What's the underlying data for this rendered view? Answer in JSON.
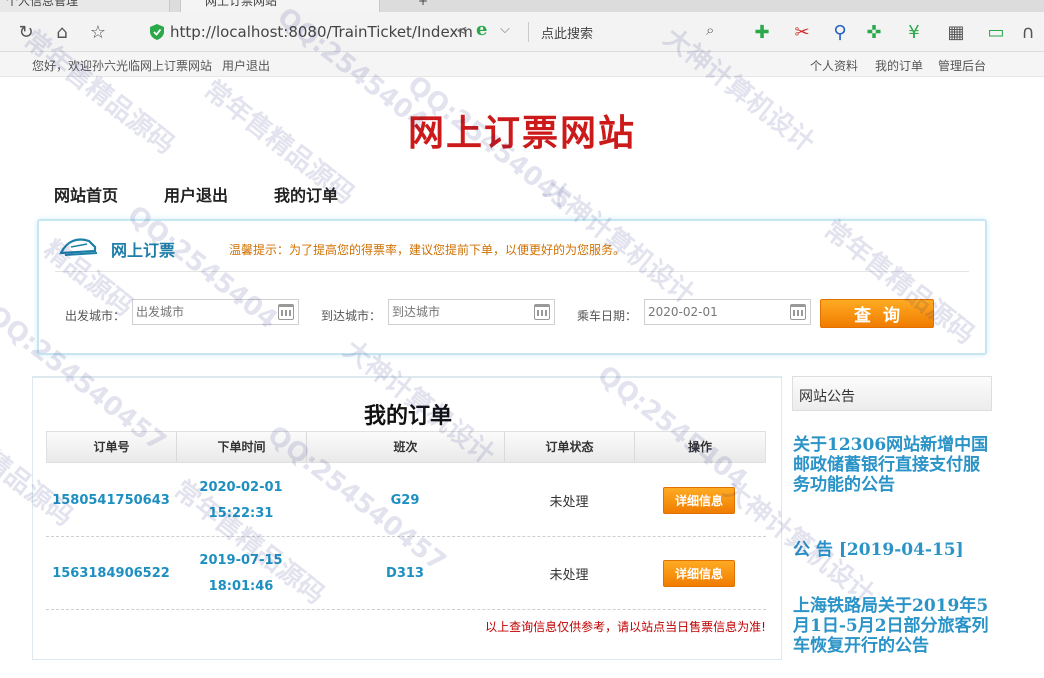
{
  "browser": {
    "tab_1_title": "个人信息管理",
    "tab_2_title": "网上订票网站",
    "url": "http://localhost:8080/TrainTicket/Indexm",
    "search_placeholder": "点此搜索"
  },
  "topbar": {
    "greeting": "您好，欢迎孙六光临网上订票网站",
    "logout": "用户退出",
    "links": [
      "个人资料",
      "我的订单",
      "管理后台"
    ]
  },
  "site_title": "网上订票网站",
  "nav": [
    "网站首页",
    "用户退出",
    "我的订单"
  ],
  "booking": {
    "title": "网上订票",
    "tip": "温馨提示：为了提高您的得票率，建议您提前下单，以便更好的为您服务。",
    "from_label": "出发城市：",
    "from_placeholder": "出发城市",
    "to_label": "到达城市：",
    "to_placeholder": "到达城市",
    "date_label": "乘车日期：",
    "date_value": "2020-02-01",
    "query_button": "查询"
  },
  "orders": {
    "title": "我的订单",
    "columns": [
      "订单号",
      "下单时间",
      "班次",
      "订单状态",
      "操作"
    ],
    "rows": [
      {
        "order_no": "1580541750643",
        "date": "2020-02-01",
        "time": "15:22:31",
        "train": "G29",
        "status": "未处理",
        "action": "详细信息"
      },
      {
        "order_no": "1563184906522",
        "date": "2019-07-15",
        "time": "18:01:46",
        "train": "D313",
        "status": "未处理",
        "action": "详细信息"
      }
    ],
    "disclaimer": "以上查询信息仅供参考，请以站点当日售票信息为准!"
  },
  "notice": {
    "title": "网站公告",
    "items": [
      "关于12306网站新增中国邮政储蓄银行直接支付服务功能的公告",
      "公 告 [2019-04-15]",
      "上海铁路局关于2019年5月1日-5月2日部分旅客列车恢复开行的公告"
    ]
  },
  "watermarks": [
    "QQ:2545404",
    "大神计算机设计",
    "常年售精品源码",
    "QQ:25454045",
    "常年售精品源码",
    "大神计算机设计",
    "QQ:2545404",
    "精品源码",
    "常年售精品源码",
    "QQ:254540457",
    "大神计算机设计",
    "QQ:2545404",
    "精品源码",
    "常年售精品源码",
    "QQ:254540457",
    "大神计算机设计"
  ],
  "colors": {
    "site_title": "#cc1a1a",
    "accent_blue": "#2a93c7",
    "button_orange": "#f07c00",
    "disclaimer_red": "#c00000"
  }
}
